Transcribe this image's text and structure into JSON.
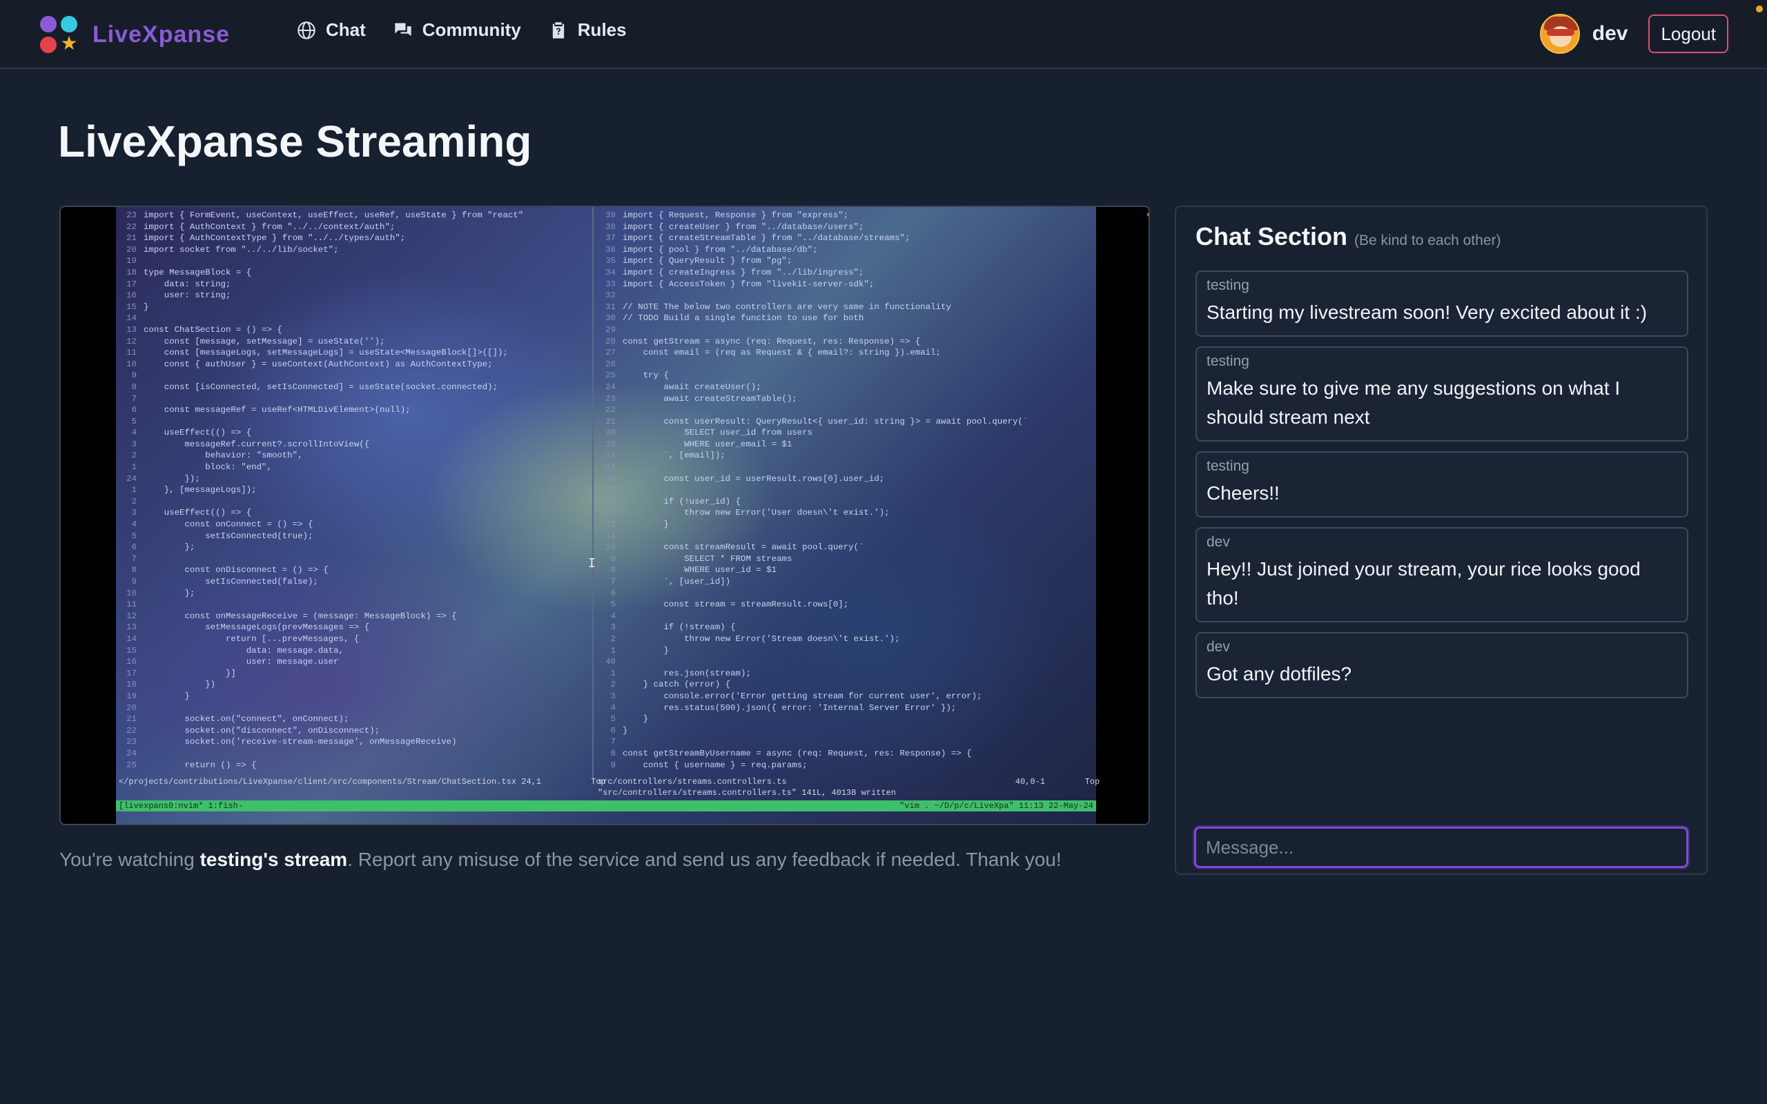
{
  "nav": {
    "brand": "LiveXpanse",
    "links": [
      {
        "label": "Chat",
        "icon": "globe-icon"
      },
      {
        "label": "Community",
        "icon": "chat-bubbles-icon"
      },
      {
        "label": "Rules",
        "icon": "clipboard-icon"
      }
    ],
    "username": "dev",
    "logout_label": "Logout"
  },
  "page": {
    "title": "LiveXpanse Streaming"
  },
  "stream": {
    "left_code": [
      {
        "n": "23",
        "t": "import { FormEvent, useContext, useEffect, useRef, useState } from \"react\""
      },
      {
        "n": "22",
        "t": "import { AuthContext } from \"../../context/auth\";"
      },
      {
        "n": "21",
        "t": "import { AuthContextType } from \"../../types/auth\";"
      },
      {
        "n": "20",
        "t": "import socket from \"../../lib/socket\";"
      },
      {
        "n": "19",
        "t": ""
      },
      {
        "n": "18",
        "t": "type MessageBlock = {"
      },
      {
        "n": "17",
        "t": "    data: string;"
      },
      {
        "n": "16",
        "t": "    user: string;"
      },
      {
        "n": "15",
        "t": "}"
      },
      {
        "n": "14",
        "t": ""
      },
      {
        "n": "13",
        "t": "const ChatSection = () => {"
      },
      {
        "n": "12",
        "t": "    const [message, setMessage] = useState('');"
      },
      {
        "n": "11",
        "t": "    const [messageLogs, setMessageLogs] = useState<MessageBlock[]>([]);"
      },
      {
        "n": "10",
        "t": "    const { authUser } = useContext(AuthContext) as AuthContextType;"
      },
      {
        "n": "9",
        "t": ""
      },
      {
        "n": "8",
        "t": "    const [isConnected, setIsConnected] = useState(socket.connected);"
      },
      {
        "n": "7",
        "t": ""
      },
      {
        "n": "6",
        "t": "    const messageRef = useRef<HTMLDivElement>(null);"
      },
      {
        "n": "5",
        "t": ""
      },
      {
        "n": "4",
        "t": "    useEffect(() => {"
      },
      {
        "n": "3",
        "t": "        messageRef.current?.scrollIntoView({"
      },
      {
        "n": "2",
        "t": "            behavior: \"smooth\","
      },
      {
        "n": "1",
        "t": "            block: \"end\","
      },
      {
        "n": "24",
        "t": "        });"
      },
      {
        "n": "1",
        "t": "    }, [messageLogs]);"
      },
      {
        "n": "2",
        "t": ""
      },
      {
        "n": "3",
        "t": "    useEffect(() => {"
      },
      {
        "n": "4",
        "t": "        const onConnect = () => {"
      },
      {
        "n": "5",
        "t": "            setIsConnected(true);"
      },
      {
        "n": "6",
        "t": "        };"
      },
      {
        "n": "7",
        "t": ""
      },
      {
        "n": "8",
        "t": "        const onDisconnect = () => {"
      },
      {
        "n": "9",
        "t": "            setIsConnected(false);"
      },
      {
        "n": "10",
        "t": "        };"
      },
      {
        "n": "11",
        "t": ""
      },
      {
        "n": "12",
        "t": "        const onMessageReceive = (message: MessageBlock) => {"
      },
      {
        "n": "13",
        "t": "            setMessageLogs(prevMessages => {"
      },
      {
        "n": "14",
        "t": "                return [...prevMessages, {"
      },
      {
        "n": "15",
        "t": "                    data: message.data,"
      },
      {
        "n": "16",
        "t": "                    user: message.user"
      },
      {
        "n": "17",
        "t": "                }]"
      },
      {
        "n": "18",
        "t": "            })"
      },
      {
        "n": "19",
        "t": "        }"
      },
      {
        "n": "20",
        "t": ""
      },
      {
        "n": "21",
        "t": "        socket.on(\"connect\", onConnect);"
      },
      {
        "n": "22",
        "t": "        socket.on(\"disconnect\", onDisconnect);"
      },
      {
        "n": "23",
        "t": "        socket.on('receive-stream-message', onMessageReceive)"
      },
      {
        "n": "24",
        "t": ""
      },
      {
        "n": "25",
        "t": "        return () => {"
      }
    ],
    "right_code": [
      {
        "n": "39",
        "t": "import { Request, Response } from \"express\";"
      },
      {
        "n": "38",
        "t": "import { createUser } from \"../database/users\";"
      },
      {
        "n": "37",
        "t": "import { createStreamTable } from \"../database/streams\";"
      },
      {
        "n": "36",
        "t": "import { pool } from \"../database/db\";"
      },
      {
        "n": "35",
        "t": "import { QueryResult } from \"pg\";"
      },
      {
        "n": "34",
        "t": "import { createIngress } from \"../lib/ingress\";"
      },
      {
        "n": "33",
        "t": "import { AccessToken } from \"livekit-server-sdk\";"
      },
      {
        "n": "32",
        "t": ""
      },
      {
        "n": "31",
        "t": "// NOTE The below two controllers are very same in functionality"
      },
      {
        "n": "30",
        "t": "// TODO Build a single function to use for both"
      },
      {
        "n": "29",
        "t": ""
      },
      {
        "n": "28",
        "t": "const getStream = async (req: Request, res: Response) => {"
      },
      {
        "n": "27",
        "t": "    const email = (req as Request & { email?: string }).email;"
      },
      {
        "n": "26",
        "t": ""
      },
      {
        "n": "25",
        "t": "    try {"
      },
      {
        "n": "24",
        "t": "        await createUser();"
      },
      {
        "n": "23",
        "t": "        await createStreamTable();"
      },
      {
        "n": "22",
        "t": ""
      },
      {
        "n": "21",
        "t": "        const userResult: QueryResult<{ user_id: string }> = await pool.query(`"
      },
      {
        "n": "20",
        "t": "            SELECT user_id from users"
      },
      {
        "n": "19",
        "t": "            WHERE user_email = $1"
      },
      {
        "n": "18",
        "t": "        `, [email]);"
      },
      {
        "n": "17",
        "t": ""
      },
      {
        "n": "16",
        "t": "        const user_id = userResult.rows[0].user_id;"
      },
      {
        "n": "15",
        "t": ""
      },
      {
        "n": "14",
        "t": "        if (!user_id) {"
      },
      {
        "n": "13",
        "t": "            throw new Error('User doesn\\'t exist.');"
      },
      {
        "n": "12",
        "t": "        }"
      },
      {
        "n": "11",
        "t": ""
      },
      {
        "n": "10",
        "t": "        const streamResult = await pool.query(`"
      },
      {
        "n": "9",
        "t": "            SELECT * FROM streams"
      },
      {
        "n": "8",
        "t": "            WHERE user_id = $1"
      },
      {
        "n": "7",
        "t": "        `, [user_id])"
      },
      {
        "n": "6",
        "t": ""
      },
      {
        "n": "5",
        "t": "        const stream = streamResult.rows[0];"
      },
      {
        "n": "4",
        "t": ""
      },
      {
        "n": "3",
        "t": "        if (!stream) {"
      },
      {
        "n": "2",
        "t": "            throw new Error('Stream doesn\\'t exist.');"
      },
      {
        "n": "1",
        "t": "        }"
      },
      {
        "n": "40",
        "t": ""
      },
      {
        "n": "1",
        "t": "        res.json(stream);"
      },
      {
        "n": "2",
        "t": "    } catch (error) {"
      },
      {
        "n": "3",
        "t": "        console.error('Error getting stream for current user', error);"
      },
      {
        "n": "4",
        "t": "        res.status(500).json({ error: 'Internal Server Error' });"
      },
      {
        "n": "5",
        "t": "    }"
      },
      {
        "n": "6",
        "t": "}"
      },
      {
        "n": "7",
        "t": ""
      },
      {
        "n": "8",
        "t": "const getStreamByUsername = async (req: Request, res: Response) => {"
      },
      {
        "n": "9",
        "t": "    const { username } = req.params;"
      }
    ],
    "status_left": "</projects/contributions/LiveXpanse/client/src/components/Stream/ChatSection.tsx 24,1          Top",
    "status_right": "src/controllers/streams.controllers.ts                                              40,0-1        Top",
    "status_message": "\"src/controllers/streams.controllers.ts\" 141L, 40138 written",
    "tmux_left": "[livexpans0:nvim* 1:fish-",
    "tmux_right": "\"vim . ~/D/p/c/LiveXpa\" 11:13 22-May-24"
  },
  "watch_note": {
    "prefix": "You're watching ",
    "streamer": "testing's stream",
    "suffix": ". Report any misuse of the service and send us any feedback if needed. Thank you!"
  },
  "chat": {
    "title": "Chat Section",
    "subtitle": "(Be kind to each other)",
    "messages": [
      {
        "user": "testing",
        "text": "Starting my livestream soon! Very excited about it :)"
      },
      {
        "user": "testing",
        "text": "Make sure to give me any suggestions on what I should stream next"
      },
      {
        "user": "testing",
        "text": "Cheers!!"
      },
      {
        "user": "dev",
        "text": "Hey!! Just joined your stream, your rice looks good tho!"
      },
      {
        "user": "dev",
        "text": "Got any dotfiles?"
      }
    ],
    "input_placeholder": "Message...",
    "input_value": ""
  },
  "colors": {
    "accent": "#8b5bd6",
    "background": "#16202e",
    "logout_border": "#e14d72"
  }
}
